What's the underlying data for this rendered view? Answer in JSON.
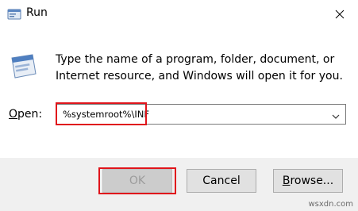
{
  "window": {
    "title": "Run",
    "icon": "run-icon",
    "close_icon": "close-icon"
  },
  "dialog": {
    "icon": "run-window-icon",
    "description": "Type the name of a program, folder, document, or Internet resource, and Windows will open it for you.",
    "open_label_mnemonic": "O",
    "open_label_rest": "pen:",
    "open_value": "%systemroot%\\INF",
    "dropdown_icon": "chevron-down-icon"
  },
  "buttons": {
    "ok": "OK",
    "cancel": "Cancel",
    "browse_mnemonic": "B",
    "browse_rest": "rowse..."
  },
  "colors": {
    "highlight": "#e0141b",
    "footer_bg": "#f0f0f0",
    "button_bg": "#e1e1e1"
  },
  "watermark": "wsxdn.com"
}
